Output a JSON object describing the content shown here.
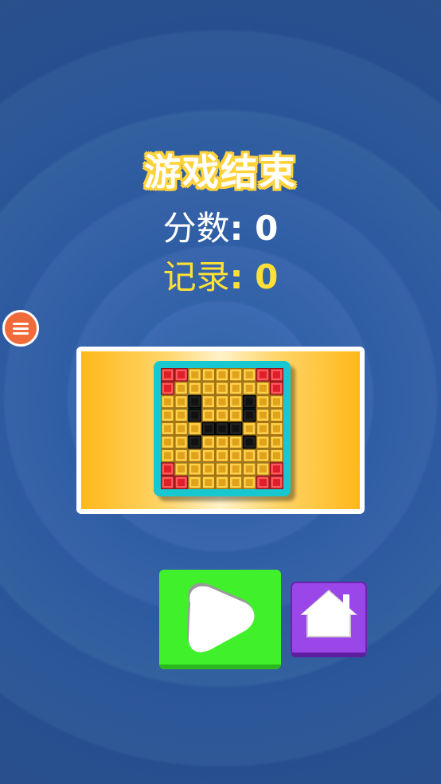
{
  "game_over": {
    "title": "游戏结束",
    "score_label": "分数",
    "score_value": "0",
    "record_label": "记录",
    "record_value": "0"
  },
  "colors": {
    "record": "#ffe135",
    "play_button": "#40f02a",
    "home_button": "#9b46e8",
    "menu_button": "#f06a3a"
  },
  "icons": {
    "menu": "hamburger-icon",
    "play": "play-icon",
    "home": "home-icon",
    "preview": "sad-face-block-icon"
  }
}
